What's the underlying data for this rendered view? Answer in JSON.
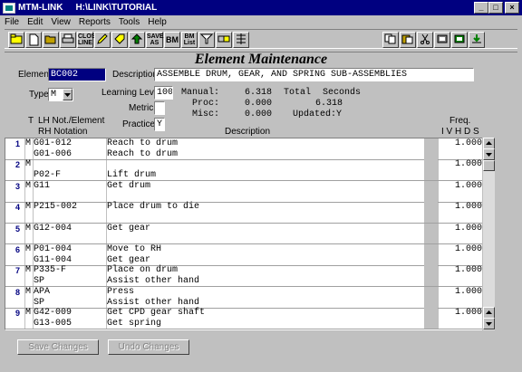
{
  "window": {
    "app_name": "MTM-LINK",
    "path": "H:\\LINK\\TUTORIAL",
    "min_glyph": "_",
    "max_glyph": "□",
    "close_glyph": "×"
  },
  "menu": [
    "File",
    "Edit",
    "View",
    "Reports",
    "Tools",
    "Help"
  ],
  "toolbar": {
    "left": [
      "open-folder-icon",
      "new-document-icon",
      "open-icon",
      "print-icon",
      "closeline-button",
      "pencil-icon",
      "tag-icon",
      "up-arrow-icon",
      "saveas-button",
      "bm-button",
      "bmlist-button",
      "filter-icon",
      "link-icon",
      "insert-icon"
    ],
    "labels": {
      "closeline": "CLOSE LINE",
      "saveas": "SAVE AS",
      "bm": "BM",
      "bmlist": "BM List"
    },
    "right": [
      "copy-icon",
      "paste-icon",
      "cut-icon",
      "db-icon",
      "db2-icon",
      "export-icon"
    ]
  },
  "form": {
    "title": "Element Maintenance",
    "element_label": "Element:",
    "element_value": "BC002",
    "description_label": "Description:",
    "description_value": "ASSEMBLE DRUM, GEAR, AND SPRING SUB-ASSEMBLIES",
    "type_label": "Type:",
    "type_value": "M",
    "learning_level_label": "Learning Level:",
    "learning_level_value": "100",
    "metric_label": "Metric:",
    "metric_value": "",
    "practice_label": "Practice:",
    "practice_value": "Y",
    "manual_label": "Manual:",
    "manual_value": "6.318",
    "proc_label": "Proc:",
    "proc_value": "0.000",
    "misc_label": "Misc:",
    "misc_value": "0.000",
    "total_label": "Total",
    "total_value": "6.318",
    "seconds_label": "Seconds",
    "updated_label": "Updated:",
    "updated_value": "Y"
  },
  "grid_header": {
    "t": "T",
    "lh_not_element": "LH Not./Element",
    "rh_notation": "RH Notation",
    "description": "Description",
    "freq": "Freq.",
    "ivhds": "I V H D S"
  },
  "rows": [
    {
      "num": "1",
      "t": "M",
      "code": "G01-012",
      "desc": "Reach to drum",
      "freq": "1.0000"
    },
    {
      "num": "",
      "t": "",
      "code": "G01-006",
      "desc": "Reach to drum",
      "freq": ""
    },
    {
      "num": "2",
      "t": "M",
      "code": "",
      "desc": "",
      "freq": "1.0000"
    },
    {
      "num": "",
      "t": "",
      "code": "P02-F",
      "desc": "Lift drum",
      "freq": ""
    },
    {
      "num": "3",
      "t": "M",
      "code": "G11",
      "desc": "Get drum",
      "freq": "1.0000"
    },
    {
      "num": "",
      "t": "",
      "code": "",
      "desc": "",
      "freq": ""
    },
    {
      "num": "4",
      "t": "M",
      "code": "P215-002",
      "desc": "Place drum to die",
      "freq": "1.0000"
    },
    {
      "num": "",
      "t": "",
      "code": "",
      "desc": "",
      "freq": ""
    },
    {
      "num": "5",
      "t": "M",
      "code": "G12-004",
      "desc": "Get gear",
      "freq": "1.0000"
    },
    {
      "num": "",
      "t": "",
      "code": "",
      "desc": "",
      "freq": ""
    },
    {
      "num": "6",
      "t": "M",
      "code": "P01-004",
      "desc": "Move to RH",
      "freq": "1.0000"
    },
    {
      "num": "",
      "t": "",
      "code": "G11-004",
      "desc": "Get gear",
      "freq": ""
    },
    {
      "num": "7",
      "t": "M",
      "code": "P335-F",
      "desc": "Place on drum",
      "freq": "1.0000"
    },
    {
      "num": "",
      "t": "",
      "code": "SP",
      "desc": "Assist other hand",
      "freq": ""
    },
    {
      "num": "8",
      "t": "M",
      "code": "APA",
      "desc": "Press",
      "freq": "1.0000"
    },
    {
      "num": "",
      "t": "",
      "code": "SP",
      "desc": "Assist other hand",
      "freq": ""
    },
    {
      "num": "9",
      "t": "M",
      "code": "G42-009",
      "desc": "Get CPD gear shaft",
      "freq": "1.0000"
    },
    {
      "num": "",
      "t": "",
      "code": "G13-005",
      "desc": "Get spring",
      "freq": ""
    }
  ],
  "buttons": {
    "save": "Save Changes",
    "undo": "Undo Changes"
  }
}
